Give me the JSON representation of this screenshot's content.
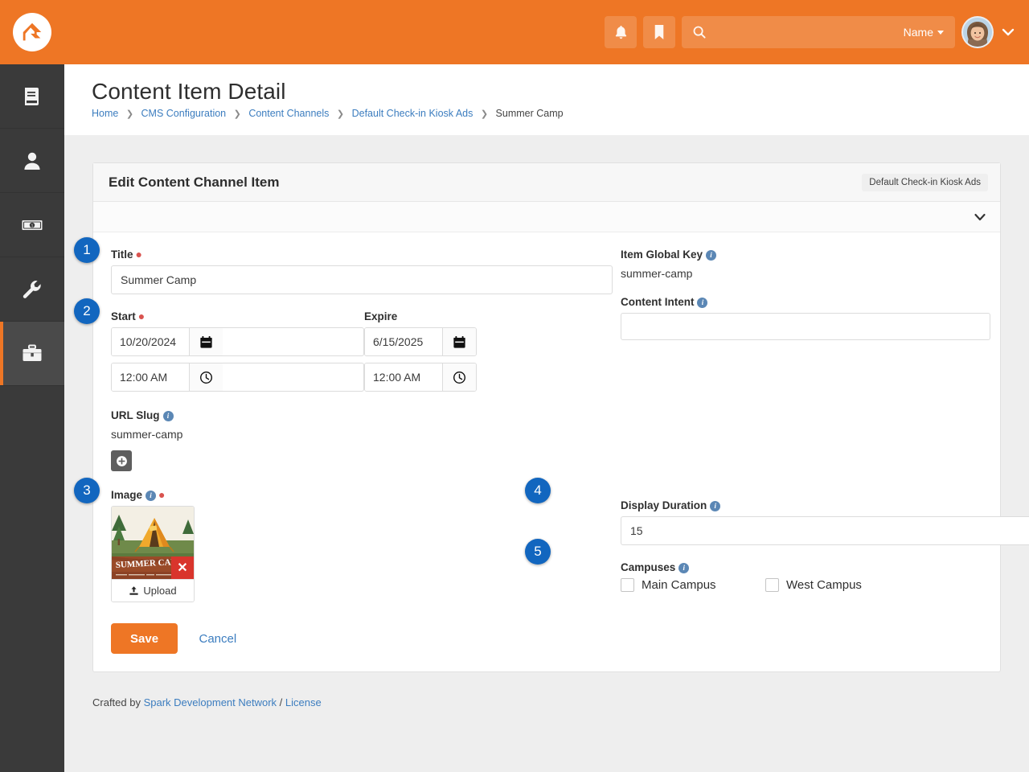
{
  "topbar": {
    "logo_name": "rock-logo",
    "notifications_icon": "bell-icon",
    "bookmarks_icon": "bookmark-icon",
    "search_icon": "search-icon",
    "search_value": "",
    "search_placeholder": "",
    "search_scope_label": "Name",
    "avatar_label": "user-avatar",
    "accent_color": "#ee7625"
  },
  "sidebar": {
    "items": [
      {
        "icon": "book-icon",
        "name": "cms",
        "active": false
      },
      {
        "icon": "person-icon",
        "name": "people",
        "active": false
      },
      {
        "icon": "money-icon",
        "name": "finance",
        "active": false
      },
      {
        "icon": "wrench-icon",
        "name": "admin",
        "active": false
      },
      {
        "icon": "toolbox-icon",
        "name": "tools",
        "active": true
      }
    ]
  },
  "page": {
    "title": "Content Item Detail",
    "breadcrumb": [
      {
        "label": "Home",
        "link": true
      },
      {
        "label": "CMS Configuration",
        "link": true
      },
      {
        "label": "Content Channels",
        "link": true
      },
      {
        "label": "Default Check-in Kiosk Ads",
        "link": true
      },
      {
        "label": "Summer Camp",
        "link": false
      }
    ]
  },
  "panel": {
    "title": "Edit Content Channel Item",
    "channel_badge": "Default Check-in Kiosk Ads",
    "collapse_icon": "chevron-down-icon"
  },
  "form": {
    "title": {
      "label": "Title",
      "required": true,
      "value": "Summer Camp"
    },
    "start": {
      "label": "Start",
      "required": true,
      "date_value": "10/20/2024",
      "time_value": "12:00 AM",
      "date_icon": "calendar-icon",
      "time_icon": "clock-icon"
    },
    "expire": {
      "label": "Expire",
      "required": false,
      "date_value": "6/15/2025",
      "time_value": "12:00 AM",
      "date_icon": "calendar-icon",
      "time_icon": "clock-icon"
    },
    "url_slug": {
      "label": "URL Slug",
      "value": "summer-camp",
      "has_info": true
    },
    "add_slug_button": {
      "icon": "plus-circle-icon",
      "label": ""
    },
    "image": {
      "label": "Image",
      "required": true,
      "has_info": true,
      "upload_label": "Upload",
      "upload_icon": "upload-icon",
      "delete_icon": "close-icon",
      "thumb_caption": "SUMMER CAMP"
    },
    "item_global_key": {
      "label": "Item Global Key",
      "value": "summer-camp",
      "has_info": true
    },
    "content_intent": {
      "label": "Content Intent",
      "value": "",
      "has_info": true
    },
    "display_duration": {
      "label": "Display Duration",
      "value": "15",
      "has_info": true
    },
    "campuses": {
      "label": "Campuses",
      "has_info": true,
      "options": [
        {
          "label": "Main Campus",
          "checked": false
        },
        {
          "label": "West Campus",
          "checked": false
        }
      ]
    }
  },
  "actions": {
    "save_label": "Save",
    "cancel_label": "Cancel"
  },
  "footer": {
    "prefix": "Crafted by ",
    "org_label": "Spark Development Network",
    "separator": " / ",
    "license_label": "License"
  },
  "callouts": [
    {
      "number": "1"
    },
    {
      "number": "2"
    },
    {
      "number": "3"
    },
    {
      "number": "4"
    },
    {
      "number": "5"
    }
  ]
}
